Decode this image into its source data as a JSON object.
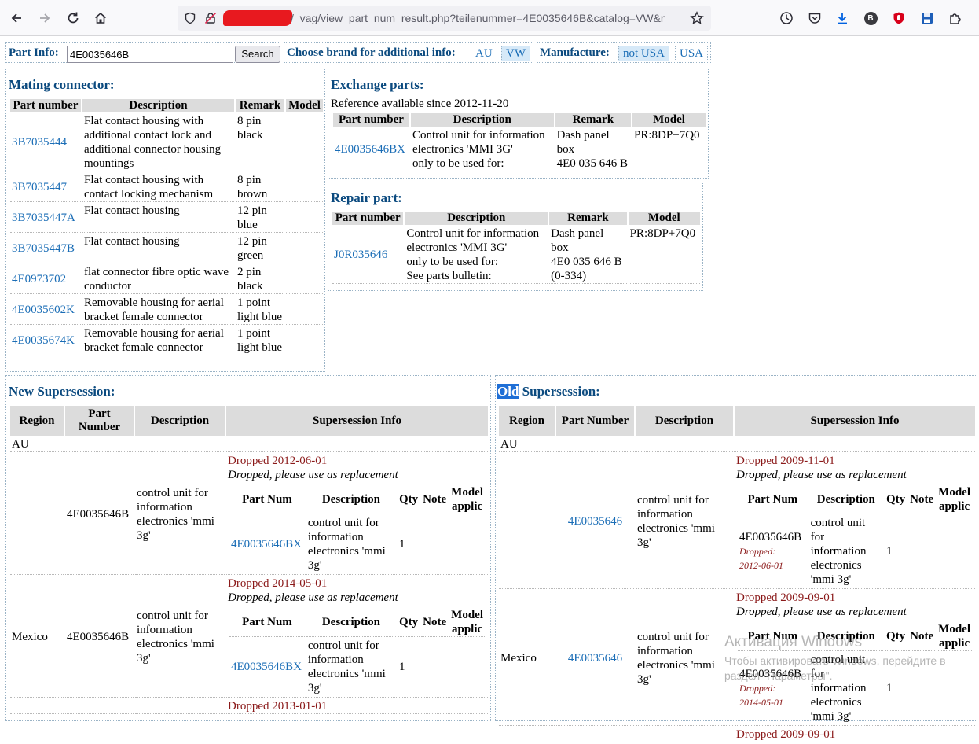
{
  "browser": {
    "url_redacted": "██████",
    "url": "/_vag/view_part_num_result.php?teilenummer=4E0035646B&catalog=VW&manu"
  },
  "top": {
    "part_info_label": "Part Info:",
    "part_info_value": "4E0035646B",
    "search_label": "Search",
    "brand_label": "Choose brand for additional info:",
    "brands": [
      "AU",
      "VW"
    ],
    "manufacture_label": "Manufacture:",
    "manufactures": [
      "not USA",
      "USA"
    ]
  },
  "mating": {
    "title": "Mating connector:",
    "headers": [
      "Part number",
      "Description",
      "Remark",
      "Model"
    ],
    "rows": [
      {
        "part": "3B7035444",
        "desc": "Flat contact housing with additional contact lock and additional connector housing mountings",
        "remark": "8 pin black",
        "model": ""
      },
      {
        "part": "3B7035447",
        "desc": "Flat contact housing with contact locking mechanism",
        "remark": "8 pin brown",
        "model": ""
      },
      {
        "part": "3B7035447A",
        "desc": "Flat contact housing",
        "remark": "12 pin blue",
        "model": ""
      },
      {
        "part": "3B7035447B",
        "desc": "Flat contact housing",
        "remark": "12 pin green",
        "model": ""
      },
      {
        "part": "4E0973702",
        "desc": "flat connector fibre optic wave conductor",
        "remark": "2 pin black",
        "model": ""
      },
      {
        "part": "4E0035602K",
        "desc": "Removable housing for aerial bracket female connector",
        "remark": "1 point light blue",
        "model": ""
      },
      {
        "part": "4E0035674K",
        "desc": "Removable housing for aerial bracket female connector",
        "remark": "1 point light blue",
        "model": ""
      }
    ]
  },
  "exchange": {
    "title": "Exchange parts:",
    "note": "Reference available since 2012-11-20",
    "headers": [
      "Part number",
      "Description",
      "Remark",
      "Model"
    ],
    "part": "4E0035646BX",
    "desc_lines": [
      "Control unit for information",
      "electronics 'MMI 3G'",
      "only to be used for:"
    ],
    "remark_lines": [
      "Dash panel",
      "box",
      "4E0 035 646 B"
    ],
    "model": "PR:8DP+7Q0"
  },
  "repair": {
    "title": "Repair part:",
    "headers": [
      "Part number",
      "Description",
      "Remark",
      "Model"
    ],
    "part": "J0R035646",
    "desc_lines": [
      "Control unit for information",
      "electronics 'MMI 3G'",
      "only to be used for:",
      "See parts bulletin:"
    ],
    "remark_lines": [
      "Dash panel",
      "box",
      "4E0 035 646 B",
      "(0-334)"
    ],
    "model": "PR:8DP+7Q0"
  },
  "new_ss": {
    "title": "New Supersession:",
    "headers": [
      "Region",
      "Part Number",
      "Description",
      "Supersession Info"
    ],
    "region_au": "AU",
    "inner_headers": [
      "Part Num",
      "Description",
      "Qty",
      "Note",
      "Model applic"
    ],
    "entries": [
      {
        "region": "",
        "part": "4E0035646B",
        "desc": "control unit for information electronics 'mmi 3g'",
        "dropped": "Dropped 2012-06-01",
        "dropped_sub": "Dropped, please use as replacement",
        "rep_part": "4E0035646BX",
        "rep_desc": "control unit for information electronics 'mmi 3g'",
        "qty": "1"
      },
      {
        "region": "Mexico",
        "part": "4E0035646B",
        "desc": "control unit for information electronics 'mmi 3g'",
        "dropped": "Dropped 2014-05-01",
        "dropped_sub": "Dropped, please use as replacement",
        "rep_part": "4E0035646BX",
        "rep_desc": "control unit for information electronics 'mmi 3g'",
        "qty": "1"
      }
    ],
    "cut_dropped": "Dropped 2013-01-01"
  },
  "old_ss": {
    "title_highlight": "Old",
    "title_rest": " Supersession:",
    "headers": [
      "Region",
      "Part Number",
      "Description",
      "Supersession Info"
    ],
    "region_au": "AU",
    "inner_headers": [
      "Part Num",
      "Description",
      "Qty",
      "Note",
      "Model applic"
    ],
    "entries": [
      {
        "region": "",
        "part": "4E0035646",
        "desc": "control unit for information electronics 'mmi 3g'",
        "dropped": "Dropped 2009-11-01",
        "dropped_sub": "Dropped, please use as replacement",
        "rep_part": "4E0035646B",
        "rep_dropped": "Dropped: 2012-06-01",
        "rep_desc": "control unit for information electronics 'mmi 3g'",
        "qty": "1"
      },
      {
        "region": "Mexico",
        "part": "4E0035646",
        "desc": "control unit for information electronics 'mmi 3g'",
        "dropped": "Dropped 2009-09-01",
        "dropped_sub": "Dropped, please use as replacement",
        "rep_part": "4E0035646B",
        "rep_dropped": "Dropped: 2014-05-01",
        "rep_desc": "control unit for information electronics 'mmi 3g'",
        "qty": "1"
      }
    ],
    "cut_dropped": "Dropped 2009-09-01"
  },
  "watermark": {
    "line1": "Активация Windows",
    "line2": "Чтобы активировать Windows, перейдите в",
    "line3": "раздел \"Параметры\"."
  }
}
